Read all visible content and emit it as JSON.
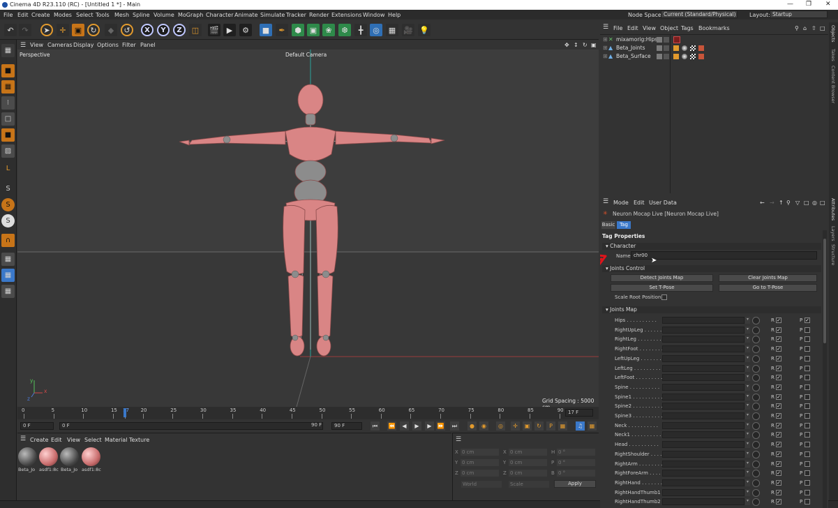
{
  "window": {
    "title": "Cinema 4D R23.110 (RC) - [Untitled 1 *] - Main"
  },
  "menu": [
    "File",
    "Edit",
    "Create",
    "Modes",
    "Select",
    "Tools",
    "Mesh",
    "Spline",
    "Volume",
    "MoGraph",
    "Character",
    "Animate",
    "Simulate",
    "Tracker",
    "Render",
    "Extensions",
    "Window",
    "Help"
  ],
  "node_space": {
    "label": "Node Space:",
    "value": "Current (Standard/Physical)"
  },
  "layout": {
    "label": "Layout:",
    "value": "Startup"
  },
  "toolbar": {
    "axis_x": "X",
    "axis_y": "Y",
    "axis_z": "Z"
  },
  "viewport": {
    "menu": [
      "View",
      "Cameras",
      "Display",
      "Options",
      "Filter",
      "Panel"
    ],
    "label": "Perspective",
    "camera": "Default Camera",
    "grid_spacing": "Grid Spacing : 5000 cm",
    "axis_y": "y",
    "axis_x": "x",
    "axis_z": "z"
  },
  "timeline": {
    "ticks": [
      "0",
      "5",
      "10",
      "15",
      "17",
      "20",
      "25",
      "30",
      "35",
      "40",
      "45",
      "50",
      "55",
      "60",
      "65",
      "70",
      "75",
      "80",
      "85",
      "90"
    ],
    "current_frame": "17 F",
    "start": "0 F",
    "min": "0 F",
    "max": "90 F",
    "end": "90 F"
  },
  "materials": {
    "menu": [
      "Create",
      "Edit",
      "View",
      "Select",
      "Material",
      "Texture"
    ],
    "items": [
      {
        "label": "Beta_Jo"
      },
      {
        "label": "asdf1:8c"
      },
      {
        "label": "Beta_Jo"
      },
      {
        "label": "asdf1:8c"
      }
    ]
  },
  "coords": {
    "x1": "X",
    "x1v": "0 cm",
    "x2": "X",
    "x2v": "0 cm",
    "h": "H",
    "hv": "0 °",
    "y1": "Y",
    "y1v": "0 cm",
    "y2": "Y",
    "y2v": "0 cm",
    "p": "P",
    "pv": "0 °",
    "z1": "Z",
    "z1v": "0 cm",
    "z2": "Z",
    "z2v": "0 cm",
    "b": "B",
    "bv": "0 °",
    "world": "World",
    "scale": "Scale",
    "apply": "Apply"
  },
  "objects": {
    "menu": [
      "File",
      "Edit",
      "View",
      "Object",
      "Tags",
      "Bookmarks"
    ],
    "rows": [
      {
        "name": "mixamorig:Hips"
      },
      {
        "name": "Beta_Joints"
      },
      {
        "name": "Beta_Surface"
      }
    ]
  },
  "attributes": {
    "menu": [
      "Mode",
      "Edit",
      "User Data"
    ],
    "title": "Neuron Mocap Live [Neuron Mocap Live]",
    "tabs": [
      "Basic",
      "Tag"
    ],
    "tag_properties": "Tag Properties",
    "section_character": "Character",
    "name_label": "Name",
    "name_value": "chr00",
    "section_joints_control": "Joints Control",
    "buttons": {
      "detect": "Detect Joints Map",
      "clear": "Clear Joints Map",
      "set_tpose": "Set T-Pose",
      "goto_tpose": "Go to T-Pose"
    },
    "scale_root": "Scale Root Position",
    "section_joints_map": "Joints Map",
    "joints": [
      {
        "name": "Hips",
        "r": true,
        "p": true
      },
      {
        "name": "RightUpLeg",
        "r": true,
        "p": false
      },
      {
        "name": "RightLeg",
        "r": true,
        "p": false
      },
      {
        "name": "RightFoot",
        "r": true,
        "p": false
      },
      {
        "name": "LeftUpLeg",
        "r": true,
        "p": false
      },
      {
        "name": "LeftLeg",
        "r": true,
        "p": false
      },
      {
        "name": "LeftFoot",
        "r": true,
        "p": false
      },
      {
        "name": "Spine",
        "r": true,
        "p": false
      },
      {
        "name": "Spine1",
        "r": true,
        "p": false
      },
      {
        "name": "Spine2",
        "r": true,
        "p": false
      },
      {
        "name": "Spine3",
        "r": true,
        "p": false
      },
      {
        "name": "Neck",
        "r": true,
        "p": false
      },
      {
        "name": "Neck1",
        "r": true,
        "p": false
      },
      {
        "name": "Head",
        "r": true,
        "p": false
      },
      {
        "name": "RightShoulder",
        "r": true,
        "p": false
      },
      {
        "name": "RightArm",
        "r": true,
        "p": false
      },
      {
        "name": "RightForeArm",
        "r": true,
        "p": false
      },
      {
        "name": "RightHand",
        "r": true,
        "p": false
      },
      {
        "name": "RightHandThumb1",
        "r": true,
        "p": false
      },
      {
        "name": "RightHandThumb2",
        "r": true,
        "p": false
      }
    ],
    "r_label": "R",
    "p_label": "P"
  },
  "right_tabs": [
    "Objects",
    "Takes",
    "Content Browser",
    "Attributes",
    "Layers",
    "Structure"
  ],
  "colors": {
    "accent": "#c77418",
    "annotation_arrow": "#e0141b",
    "mesh": "#d98585",
    "selection_blue": "#3a78c9"
  }
}
